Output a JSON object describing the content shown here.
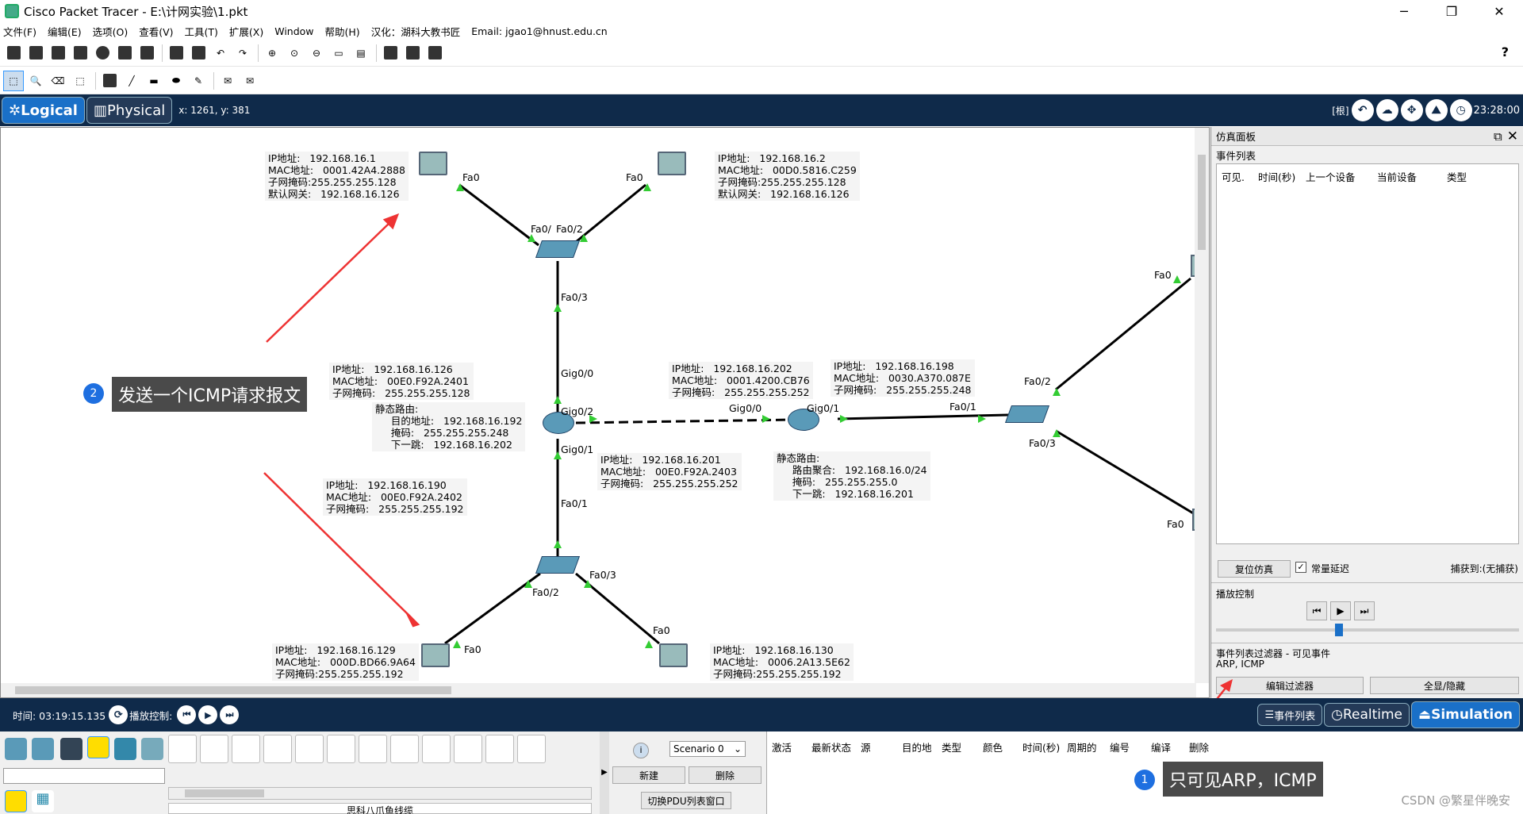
{
  "window": {
    "title": "Cisco Packet Tracer - E:\\计网实验\\1.pkt"
  },
  "menu": [
    "文件(F)",
    "编辑(E)",
    "选项(O)",
    "查看(V)",
    "工具(T)",
    "扩展(X)",
    "Window",
    "帮助(H)",
    "汉化：湖科大教书匠",
    "Email: jgao1@hnust.edu.cn"
  ],
  "toolbar": {
    "help": "?"
  },
  "modes": {
    "logical": "Logical",
    "physical": "Physical",
    "coords": "x: 1261, y: 381",
    "root": "[根]",
    "clock": "23:28:00"
  },
  "network": {
    "pc_top_left": {
      "lines": [
        "IP地址:   192.168.16.1",
        "MAC地址:   0001.42A4.2888",
        "子网掩码:255.255.255.128",
        "默认网关:   192.168.16.126"
      ]
    },
    "pc_top_right": {
      "lines": [
        "IP地址:   192.168.16.2",
        "MAC地址:   00D0.5816.C259",
        "子网掩码:255.255.255.128",
        "默认网关:   192.168.16.126"
      ]
    },
    "router1_g00": {
      "lines": [
        "IP地址:   192.168.16.126",
        "MAC地址:   00E0.F92A.2401",
        "子网掩码:   255.255.255.128"
      ]
    },
    "router1_static": {
      "lines": [
        "静态路由:",
        "     目的地址:   192.168.16.192",
        "     掩码:   255.255.255.248",
        "     下一跳:   192.168.16.202"
      ]
    },
    "router1_g02": {
      "lines": [
        "IP地址:   192.168.16.202",
        "MAC地址:   0001.4200.CB76",
        "子网掩码:   255.255.255.252"
      ]
    },
    "router2_g01": {
      "lines": [
        "IP地址:   192.168.16.198",
        "MAC地址:   0030.A370.087E",
        "子网掩码:   255.255.255.248"
      ]
    },
    "router2_g00": {
      "lines": [
        "IP地址:   192.168.16.201",
        "MAC地址:   00E0.F92A.2403",
        "子网掩码:   255.255.255.252"
      ]
    },
    "router2_static": {
      "lines": [
        "静态路由:",
        "     路由聚合:   192.168.16.0/24",
        "     掩码:   255.255.255.0",
        "     下一跳:   192.168.16.201"
      ]
    },
    "router1_g01": {
      "lines": [
        "IP地址:   192.168.16.190",
        "MAC地址:   00E0.F92A.2402",
        "子网掩码:   255.255.255.192"
      ]
    },
    "pc_bottom_left": {
      "lines": [
        "IP地址:   192.168.16.129",
        "MAC地址:   000D.BD66.9A64",
        "子网掩码:255.255.255.192"
      ]
    },
    "pc_bottom_right": {
      "lines": [
        "IP地址:   192.168.16.130",
        "MAC地址:   0006.2A13.5E62",
        "子网掩码:255.255.255.192"
      ]
    },
    "ports": {
      "fa0": "Fa0",
      "fa0_12": "Fa0/",
      "fa0_2": "Fa0/2",
      "fa0_3": "Fa0/3",
      "gig0_0": "Gig0/0",
      "gig0_2": "Gig0/2",
      "gig0_1": "Gig0/1",
      "fa0_1": "Fa0/1"
    }
  },
  "annotations": {
    "send_icmp": "发送一个ICMP请求报文",
    "send_icmp_num": "2",
    "only_arp": "只可见ARP，ICMP",
    "only_arp_num": "1"
  },
  "sim_panel": {
    "title": "仿真面板",
    "event_list": "事件列表",
    "cols": [
      "可见.",
      "时间(秒)",
      "上一个设备",
      "当前设备",
      "类型"
    ],
    "reset": "复位仿真",
    "const_delay": "常量延迟",
    "captured": "捕获到:(无捕获)",
    "playback": "播放控制",
    "filter_title": "事件列表过滤器 - 可见事件",
    "filter_value": "ARP, ICMP",
    "edit_filter": "编辑过滤器",
    "show_hide": "全显/隐藏"
  },
  "bottom": {
    "time": "时间: 03:19:15.135",
    "play_ctrl": "播放控制:",
    "event_list_btn": "事件列表",
    "realtime": "Realtime",
    "simulation": "Simulation",
    "scenario": "Scenario 0",
    "new": "新建",
    "delete": "删除",
    "toggle_pdu": "切换PDU列表窗口",
    "cable_name": "思科八爪鱼线缆",
    "pdu_cols": [
      "激活",
      "最新状态",
      "源",
      "目的地",
      "类型",
      "颜色",
      "时间(秒)",
      "周期的",
      "编号",
      "编译",
      "删除"
    ],
    "info_num": "i"
  },
  "watermark": "CSDN @繁星伴晚安"
}
